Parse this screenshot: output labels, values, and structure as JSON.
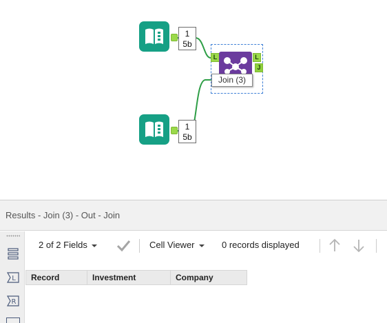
{
  "canvas": {
    "input_1": {
      "count_line1": "1",
      "count_line2": "5b"
    },
    "input_2": {
      "count_line1": "1",
      "count_line2": "5b"
    },
    "join_tool": {
      "label": "Join (3)",
      "input_left_label": "L",
      "output_left_label": "L",
      "output_join_label": "J"
    },
    "colors": {
      "input_tool": "#16a085",
      "join_tool": "#6b3b9e",
      "anchor": "#9bd94a",
      "connection": "#2e9e46",
      "selection": "#3d7fd6"
    }
  },
  "results": {
    "title": "Results - Join (3) - Out - Join",
    "toolbar": {
      "fields_label": "2 of 2 Fields",
      "cell_viewer_label": "Cell Viewer",
      "records_label": "0 records displayed"
    },
    "side_buttons": {
      "left_label": "L",
      "right_label": "R"
    },
    "columns": [
      "Record",
      "Investment",
      "Company"
    ]
  }
}
